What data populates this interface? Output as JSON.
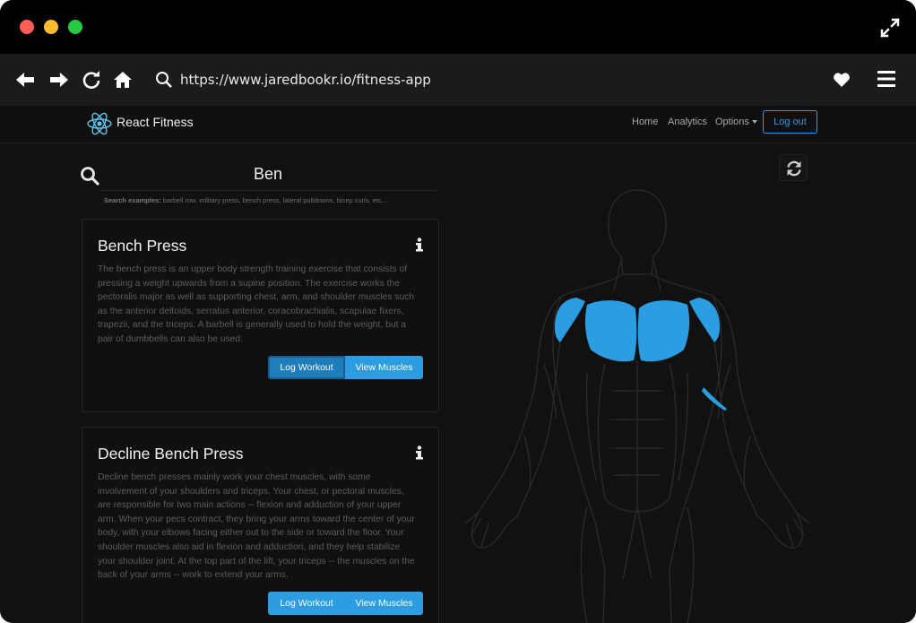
{
  "browser": {
    "url": "https://www.jaredbookr.io/fitness-app"
  },
  "app": {
    "brand": "React Fitness",
    "nav": {
      "home": "Home",
      "analytics": "Analytics",
      "options": "Options",
      "logout": "Log out"
    }
  },
  "search": {
    "value": "Ben",
    "hint_label": "Search examples:",
    "hint_examples": "barbell row, military press, bench press, lateral pulldowns, bicep curls, etc..."
  },
  "exercises": [
    {
      "title": "Bench Press",
      "description": "The bench press is an upper body strength training exercise that consists of pressing a weight upwards from a supine position. The exercise works the pectoralis major as well as supporting chest, arm, and shoulder muscles such as the anterior deltoids, serratus anterior, coracobrachialis, scapulae fixers, trapezii, and the triceps. A barbell is generally used to hold the weight, but a pair of dumbbells can also be used.",
      "log_label": "Log Workout",
      "view_label": "View Muscles"
    },
    {
      "title": "Decline Bench Press",
      "description": "Decline bench presses mainly work your chest muscles, with some involvement of your shoulders and triceps. Your chest, or pectoral muscles, are responsible for two main actions -- flexion and adduction of your upper arm. When your pecs contract, they bring your arms toward the center of your body, with your elbows facing either out to the side or toward the floor. Your shoulder muscles also aid in flexion and adduction, and they help stabilize your shoulder joint. At the top part of the lift, your triceps -- the muscles on the back of your arms -- work to extend your arms.",
      "log_label": "Log Workout",
      "view_label": "View Muscles"
    }
  ],
  "colors": {
    "accent": "#2b9de0",
    "muscle_highlight": "#2b9de0",
    "body_outline": "#2a2a2a",
    "background": "#111111"
  },
  "icons": {
    "back": "arrow-left-icon",
    "forward": "arrow-right-icon",
    "reload": "reload-icon",
    "home": "home-icon",
    "search": "search-icon",
    "favorite": "heart-icon",
    "menu": "hamburger-icon",
    "fullscreen": "expand-icon",
    "brand": "react-atom-icon",
    "info": "info-icon",
    "refresh": "refresh-icon"
  }
}
